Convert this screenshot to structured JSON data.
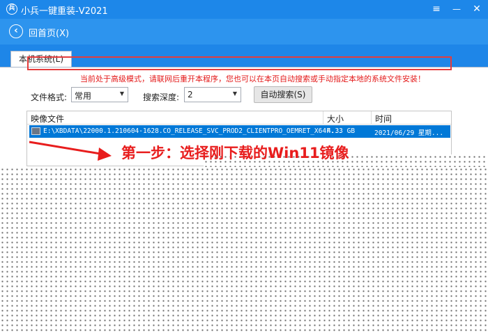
{
  "app": {
    "title": "小兵一键重装-V2021",
    "logo_icon": "app-logo-icon"
  },
  "window_controls": {
    "menu": "≡",
    "minimize": "—",
    "close": "✕"
  },
  "nav": {
    "back_label": "回首页(X)"
  },
  "tabs": [
    {
      "label": "本机系统(L)"
    }
  ],
  "notice": "当前处于高级模式，请联网后重开本程序，您也可以在本页自动搜索或手动指定本地的系统文件安装！",
  "filters": {
    "format_label": "文件格式:",
    "format_value": "常用",
    "depth_label": "搜索深度:",
    "depth_value": "2",
    "search_button": "自动搜索(S)"
  },
  "table": {
    "columns": [
      "映像文件",
      "大小",
      "时间"
    ],
    "rows": [
      {
        "file": "E:\\XBDATA\\22000.1.210604-1628.CO_RELEASE_SVC_PROD2_CLIENTPRO_OEMRET_X64F...",
        "size": "4.33 GB",
        "time": "2021/06/29 星期..."
      }
    ]
  },
  "annotation": "第一步：选择刚下载的Win11镜像",
  "colors": {
    "titlebar": "#1d87e9",
    "accent_red": "#e81d1d",
    "selection": "#0078d7"
  }
}
